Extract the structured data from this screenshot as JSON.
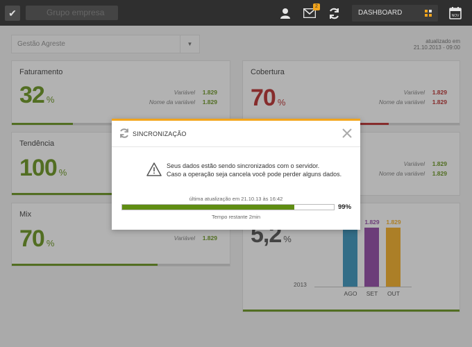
{
  "topbar": {
    "company_placeholder": "Grupo empresa",
    "mail_badge": "2",
    "dashboard_label": "DASHBOARD",
    "calendar_label": "NOV",
    "accent": "#f3a51c"
  },
  "subheader": {
    "gestao_value": "Gestão Agreste",
    "updated_label": "atualizado em",
    "updated_date": "21.10.2013 - 09:00"
  },
  "cards": {
    "faturamento": {
      "title": "Faturamento",
      "value": "32",
      "unit": "%",
      "k1": "Variável",
      "v1": "1.829",
      "k2": "Nome da variável",
      "v2": "1.829",
      "progress": 0.32
    },
    "cobertura": {
      "title": "Cobertura",
      "value": "70",
      "unit": "%",
      "k1": "Variável",
      "v1": "1.829",
      "k2": "Nome da variável",
      "v2": "1.829",
      "progress": 0.7
    },
    "tendencia": {
      "title": "Tendência",
      "value": "100",
      "unit": "%",
      "progress": 1.0
    },
    "right2": {
      "k1": "Variável",
      "v1": "1.829",
      "k2": "Nome da variável",
      "v2": "1.829"
    },
    "mix": {
      "title": "Mix",
      "value": "70",
      "unit": "%",
      "k1": "Variável",
      "v1": "1.829",
      "progress": 0.7
    },
    "chart_card": {
      "value": "5,2",
      "unit": "%",
      "year": "2013"
    }
  },
  "chart_data": {
    "type": "bar",
    "categories": [
      "AGO",
      "SET",
      "OUT"
    ],
    "values": [
      1.829,
      1.829,
      1.829
    ],
    "value_labels": [
      "",
      "1.829",
      "1.829"
    ],
    "colors": [
      "#2e8bb5",
      "#8a3e9e",
      "#f0a81a"
    ]
  },
  "modal": {
    "title": "SINCRONIZAÇÃO",
    "message_line1": "Seus dados estão sendo sincronizados com o servidor.",
    "message_line2": "Caso a operação seja cancela você pode perder alguns dados.",
    "last_update": "última atualização em 21.10.13 às 16:42",
    "progress": 0.99,
    "progress_label": "99%",
    "remaining": "Tempo restante 2min"
  }
}
